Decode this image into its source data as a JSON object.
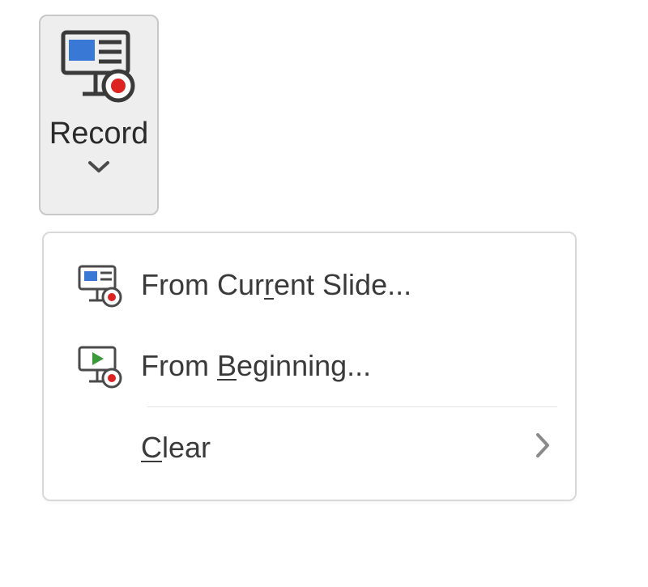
{
  "ribbon": {
    "record_button_label": "Record"
  },
  "menu": {
    "items": [
      {
        "label_pre": "From Cur",
        "label_accel": "r",
        "label_post": "ent Slide...",
        "has_submenu": false,
        "icon": "slide-record"
      },
      {
        "label_pre": "From ",
        "label_accel": "B",
        "label_post": "eginning...",
        "has_submenu": false,
        "icon": "play-record"
      },
      {
        "label_pre": "",
        "label_accel": "C",
        "label_post": "lear",
        "has_submenu": true,
        "icon": ""
      }
    ]
  }
}
